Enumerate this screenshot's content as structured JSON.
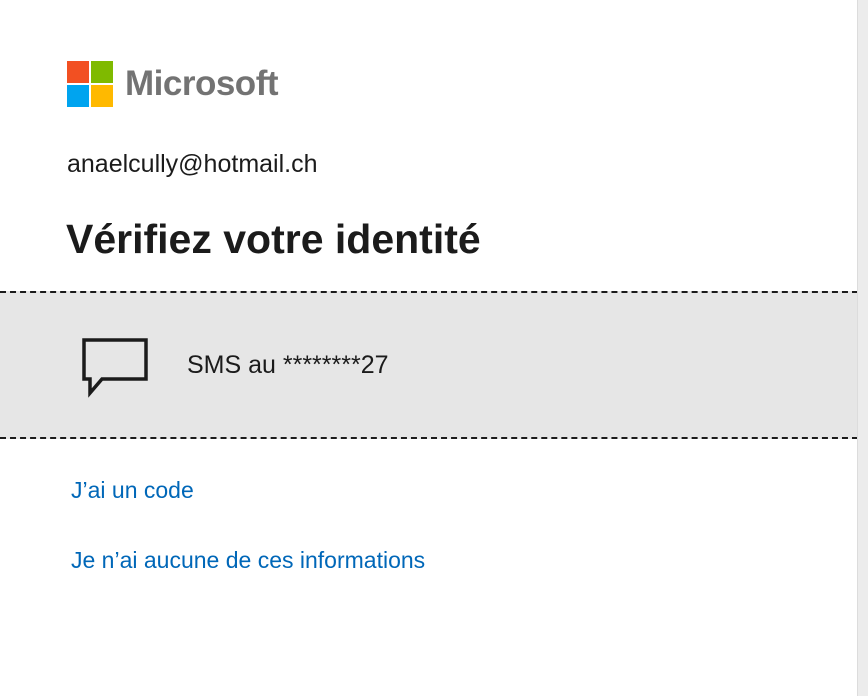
{
  "brand": {
    "name": "Microsoft",
    "colors": {
      "red": "#f25022",
      "green": "#7fba00",
      "blue": "#00a4ef",
      "yellow": "#ffb900",
      "text": "#737373"
    }
  },
  "account": {
    "email": "anaelcully@hotmail.ch"
  },
  "page": {
    "title": "Vérifiez votre identité"
  },
  "verification_options": [
    {
      "icon": "chat-bubble-icon",
      "label": "SMS au ********27",
      "selected": true
    }
  ],
  "links": {
    "have_code": "J’ai un code",
    "no_info": "Je n’ai aucune de ces informations"
  },
  "theme": {
    "link_color": "#0067b8",
    "option_background": "#e6e6e6",
    "text_color": "#1b1b1b"
  }
}
